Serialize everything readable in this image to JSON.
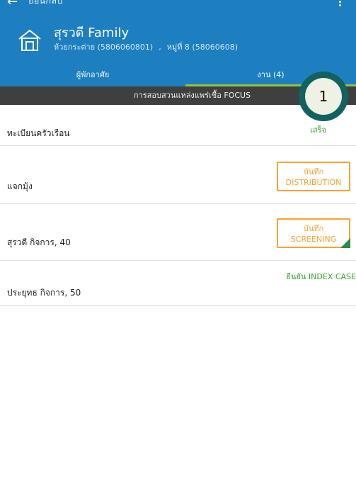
{
  "header": {
    "back_label": "ย้อนกลับ",
    "family_name": "สุรวดี Family",
    "village_name": "ห้วยกระต่าย (5806060801)",
    "separator": ",",
    "moo": "หมู่ที่ 8 (58060608)"
  },
  "tabs": [
    {
      "label": "ผู้พักอาศัย",
      "active": false
    },
    {
      "label": "งาน (4)",
      "active": true
    }
  ],
  "focus_bar": "การสอบสวนแหล่งแพร่เชื้อ FOCUS",
  "marker": {
    "number": "1"
  },
  "tasks": [
    {
      "label": "ทะเบียนครัวเรือน",
      "status": "เสร็จ"
    },
    {
      "label": "แจกมุ้ง",
      "action_top": "บันทึก",
      "action_bottom": "DISTRIBUTION"
    },
    {
      "label": "สุรวดี  กิจการ, 40",
      "action_top": "บันทึก",
      "action_bottom": "SCREENING"
    },
    {
      "label": "ประยุทธ  กิจการ, 50",
      "status": "ยืนยัน INDEX CASE"
    }
  ],
  "colors": {
    "appbar": "#1e7fc0",
    "accent_green": "#8cc63f",
    "action_orange": "#f7a335",
    "status_green": "#3aa82f",
    "focus_bar": "#3f3f3f"
  }
}
